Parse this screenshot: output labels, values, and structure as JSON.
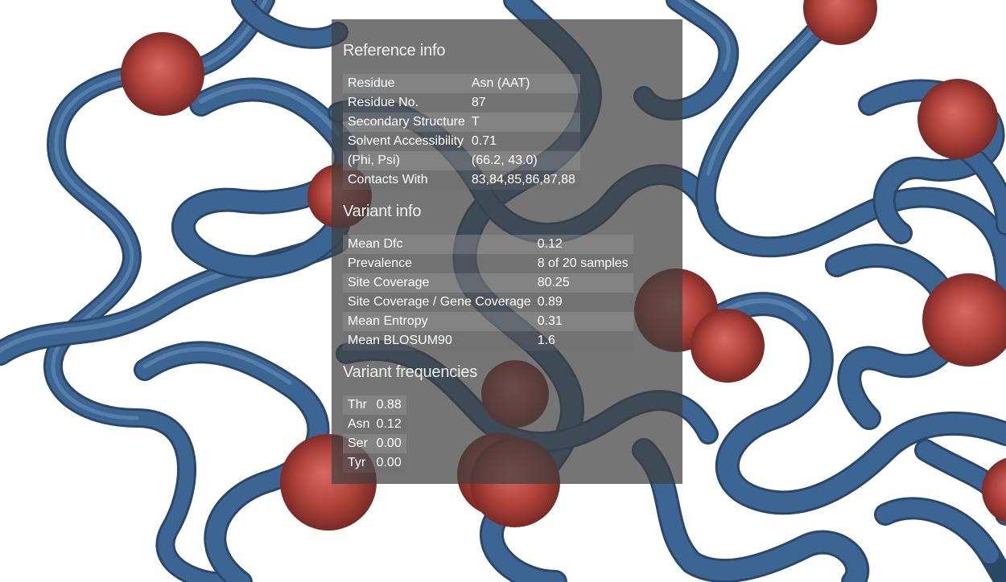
{
  "reference": {
    "title": "Reference info",
    "rows": [
      {
        "label": "Residue",
        "value": "Asn (AAT)"
      },
      {
        "label": "Residue No.",
        "value": "87"
      },
      {
        "label": "Secondary Structure",
        "value": "T"
      },
      {
        "label": "Solvent Accessibility",
        "value": "0.71"
      },
      {
        "label": "(Phi, Psi)",
        "value": "(66.2, 43.0)"
      },
      {
        "label": "Contacts With",
        "value": "83,84,85,86,87,88"
      }
    ]
  },
  "variant": {
    "title": "Variant info",
    "rows": [
      {
        "label": "Mean Dfc",
        "value": "0.12"
      },
      {
        "label": "Prevalence",
        "value": "8 of 20 samples"
      },
      {
        "label": "Site Coverage",
        "value": "80.25"
      },
      {
        "label": "Site Coverage / Gene Coverage",
        "value": "0.89"
      },
      {
        "label": "Mean Entropy",
        "value": "0.31"
      },
      {
        "label": "Mean BLOSUM90",
        "value": "1.6"
      }
    ]
  },
  "frequencies": {
    "title": "Variant frequencies",
    "rows": [
      {
        "label": "Thr",
        "value": "0.88"
      },
      {
        "label": "Asn",
        "value": "0.12"
      },
      {
        "label": "Ser",
        "value": "0.00"
      },
      {
        "label": "Tyr",
        "value": "0.00"
      }
    ]
  },
  "colors": {
    "ribbon": "#3d6593",
    "sphere": "#b5433d",
    "panel": "rgba(64,64,64,0.72)"
  }
}
